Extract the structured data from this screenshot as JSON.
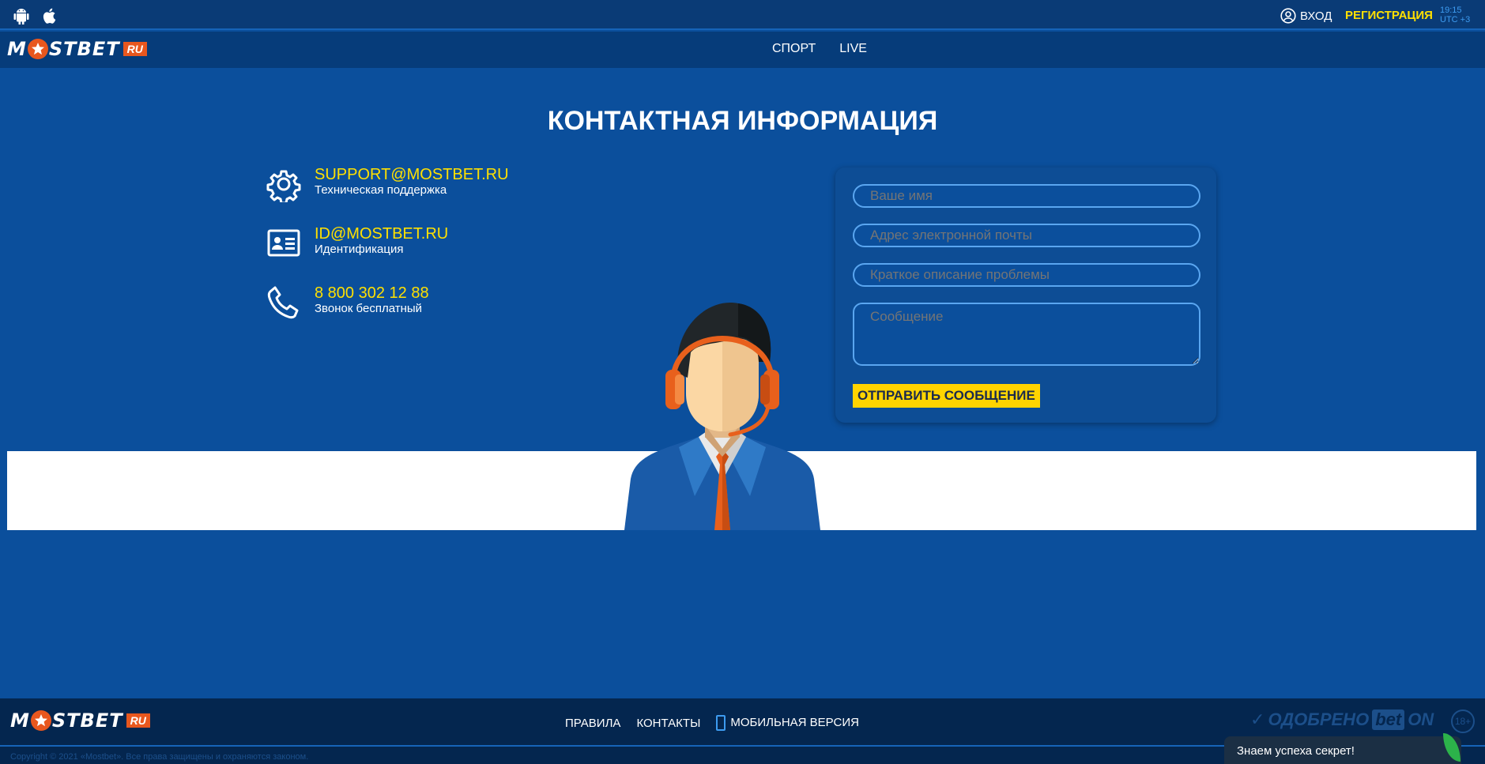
{
  "header": {
    "login_label": "ВХОД",
    "register_label": "РЕГИСТРАЦИЯ",
    "time": "19:15",
    "timezone": "UTC +3"
  },
  "logo": {
    "text_before": "M",
    "text_after": "STBET",
    "suffix": "RU"
  },
  "nav": {
    "items": [
      "СПОРТ",
      "LIVE"
    ]
  },
  "page_title": "КОНТАКТНАЯ ИНФОРМАЦИЯ",
  "contacts": [
    {
      "icon": "gear-icon",
      "value": "SUPPORT@MOSTBET.RU",
      "label": "Техническая поддержка"
    },
    {
      "icon": "id-card-icon",
      "value": "ID@MOSTBET.RU",
      "label": "Идентификация"
    },
    {
      "icon": "phone-icon",
      "value": "8 800 302 12 88",
      "label": "Звонок бесплатный"
    }
  ],
  "form": {
    "name_placeholder": "Ваше имя",
    "email_placeholder": "Адрес электронной почты",
    "subject_placeholder": "Краткое описание проблемы",
    "message_placeholder": "Сообщение",
    "submit_label": "ОТПРАВИТЬ СООБЩЕНИЕ"
  },
  "footer": {
    "links": [
      "ПРАВИЛА",
      "КОНТАКТЫ",
      "МОБИЛЬНАЯ ВЕРСИЯ"
    ],
    "copyright": "Copyright © 2021 «Mostbet». Все права защищены и охраняются законом.",
    "approved_text": "ОДОБРЕНО",
    "bet": "bet",
    "on": "ON",
    "age": "18+"
  },
  "chat_popup": {
    "text": "Знаем успеха секрет!"
  },
  "colors": {
    "background": "#0b4f9c",
    "accent_yellow": "#ffe000",
    "brand_orange": "#e8571e",
    "footer_bg": "#04264f"
  }
}
